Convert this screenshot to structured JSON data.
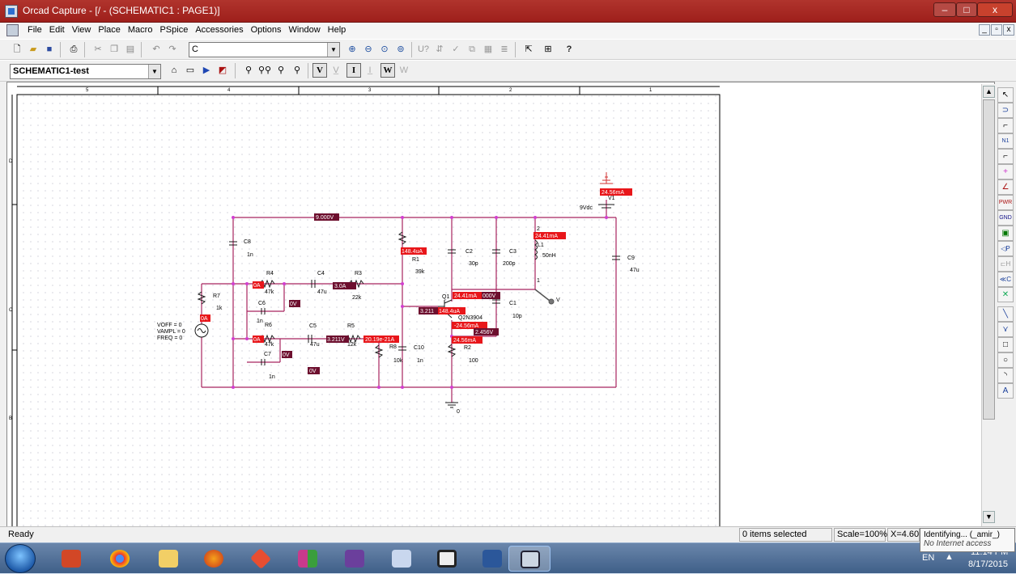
{
  "window": {
    "title": "Orcad Capture - [/ - (SCHEMATIC1 : PAGE1)]",
    "controls": [
      "–",
      "□",
      "x"
    ]
  },
  "menubar": {
    "items": [
      "File",
      "Edit",
      "View",
      "Place",
      "Macro",
      "PSpice",
      "Accessories",
      "Options",
      "Window",
      "Help"
    ],
    "mdi_controls": [
      "_",
      "\u0000",
      "x"
    ]
  },
  "toolbar1": {
    "part_combo_value": "C"
  },
  "toolbar2": {
    "profile_combo_value": "SCHEMATIC1-test",
    "v_label": "V",
    "i_label": "I",
    "w_label": "W"
  },
  "border": {
    "top_zones": [
      "5",
      "4",
      "3",
      "2",
      "1"
    ],
    "left_zones": [
      "D",
      "C",
      "B"
    ]
  },
  "schematic": {
    "labels": {
      "c8": "C8",
      "c8v": "1n",
      "r4": "R4",
      "r4v": "47k",
      "c4": "C4",
      "c4v": "47u",
      "r3": "R3",
      "r3v": "22k",
      "r1": "R1",
      "r1v": "39k",
      "c2": "C2",
      "c2v": "30p",
      "c3": "C3",
      "c3v": "200p",
      "l1": "L1",
      "l1v": "50nH",
      "l1pin": "2",
      "l1pin1": "1",
      "c9": "C9",
      "c9v": "47u",
      "r7": "R7",
      "r7v": "1k",
      "c6": "C6",
      "c6v": "1n",
      "voff": "VOFF = 0",
      "vampl": "VAMPL = 0",
      "freq": "FREQ = 0",
      "r6": "R6",
      "r6v": "47k",
      "c5": "C5",
      "c5v": "47u",
      "r5": "R5",
      "r5v": "12k",
      "c7": "C7",
      "c7v": "1n",
      "r8v": "10k",
      "r8": "R8",
      "c10": "C10",
      "c10v": "1n",
      "q1": "Q1",
      "q1model": "Q2N3904",
      "r2": "R2",
      "r2v": "100",
      "c1": "C1",
      "c1v": "10p",
      "v1": "9Vdc",
      "v1name": "V1",
      "gnd": "0",
      "probe": "V"
    },
    "markers": {
      "m_9v": "9.000V",
      "m_148a": "148.4uA",
      "m_2441": "24.41mA",
      "m_2456top": "24.56mA",
      "m_0a1": "0A",
      "m_30a": "3.0A",
      "m_0a2": "0A",
      "m_0v1": "0V",
      "m_0a3": "0A",
      "m_0a4": "0A",
      "m_3211a": "3.211V",
      "m_2019": "20.19e-21A",
      "m_0v2": "0V",
      "m_0vbot": "0V",
      "m_2441b": "24.41mA",
      "m_000v": "000V",
      "m_3211b": "3.211",
      "m_1484b": "148.4uA",
      "m_2456a": "-24.56mA",
      "m_2456v": "2.456V",
      "m_2456b": "24.56mA"
    }
  },
  "status": {
    "ready": "Ready",
    "selected": "0 items selected",
    "scale": "Scale=100%",
    "coords": "X=4.60"
  },
  "tooltip": {
    "line1": "Identifying... (_amir_)",
    "line2": "No Internet access"
  },
  "taskbar": {
    "lang": "EN",
    "time": "11:14 PM",
    "date": "8/17/2015"
  },
  "colors": {
    "title_bg": "#a52a25",
    "wire": "#a8245f",
    "marker_red": "#e8161a",
    "marker_dark": "#6d0f2e",
    "junction": "#d23fd0"
  }
}
